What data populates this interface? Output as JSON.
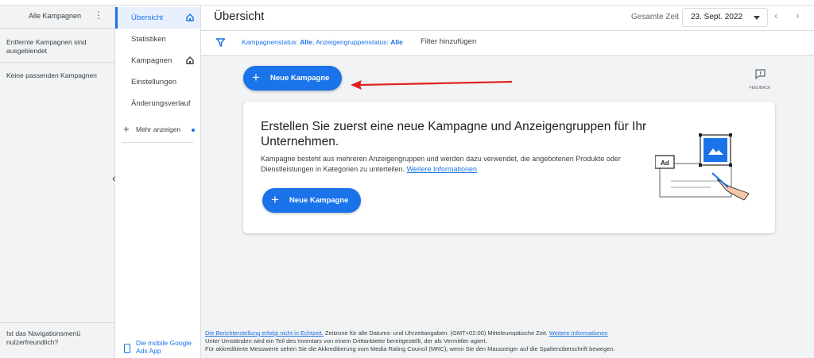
{
  "campaign_panel": {
    "title": "Alle Kampagnen",
    "removed_note": "Entfernte Kampagnen sind ausgeblendet",
    "empty_note": "Keine passenden Kampagnen",
    "feedback_question": "Ist das Navigationsmenü nutzerfreundlich?"
  },
  "nav": {
    "items": [
      {
        "label": "Übersicht",
        "active": true,
        "home_icon": true
      },
      {
        "label": "Statistiken"
      },
      {
        "label": "Kampagnen",
        "home_icon": true
      },
      {
        "label": "Einstellungen"
      },
      {
        "label": "Änderungsverlauf"
      }
    ],
    "more_label": "Mehr anzeigen",
    "app_label": "Die mobile Google Ads App"
  },
  "header": {
    "title": "Übersicht",
    "range_label": "Gesamte Zeit",
    "date_value": "23. Sept. 2022"
  },
  "filter": {
    "status_label": "Kampagnenstatus:",
    "status_value": "Alle",
    "group_label": "Anzeigengruppenstatus:",
    "group_value": "Alle",
    "add_label": "Filter hinzufügen"
  },
  "buttons": {
    "new_campaign": "Neue Kampagne",
    "new_campaign_card": "Neue Kampagne",
    "feedback": "FEEDBACK"
  },
  "card": {
    "heading": "Erstellen Sie zuerst eine neue Kampagne und Anzeigengruppen für Ihr Unternehmen.",
    "description": "Kampagne besteht aus mehreren Anzeigengruppen und werden dazu verwendet, die angebotenen Produkte oder Dienstleistungen in Kategorien zu unterteilen.",
    "link": "Weitere Informationen",
    "illustration_label": "Ad"
  },
  "footer": {
    "line1_link": "Die Berichterstellung erfolgt nicht in Echtzeit.",
    "line1_text": " Zeitzone für alle Datums- und Uhrzeitangaben: (GMT+02:00) Mitteleuropäische Zeit. ",
    "line1_link2": "Weitere Informationen",
    "line2": "Unter Umständen wird ein Teil des Inventars von einem Drittanbieter bereitgestellt, der als Vermittler agiert.",
    "line3": "Für akkreditierte Messwerte sehen Sie die Akkreditierung vom Media Rating Council (MRC), wenn Sie den Mauszeiger auf die Spaltenüberschrift bewegen."
  },
  "colors": {
    "accent": "#1a73e8",
    "arrow": "#e02020"
  }
}
